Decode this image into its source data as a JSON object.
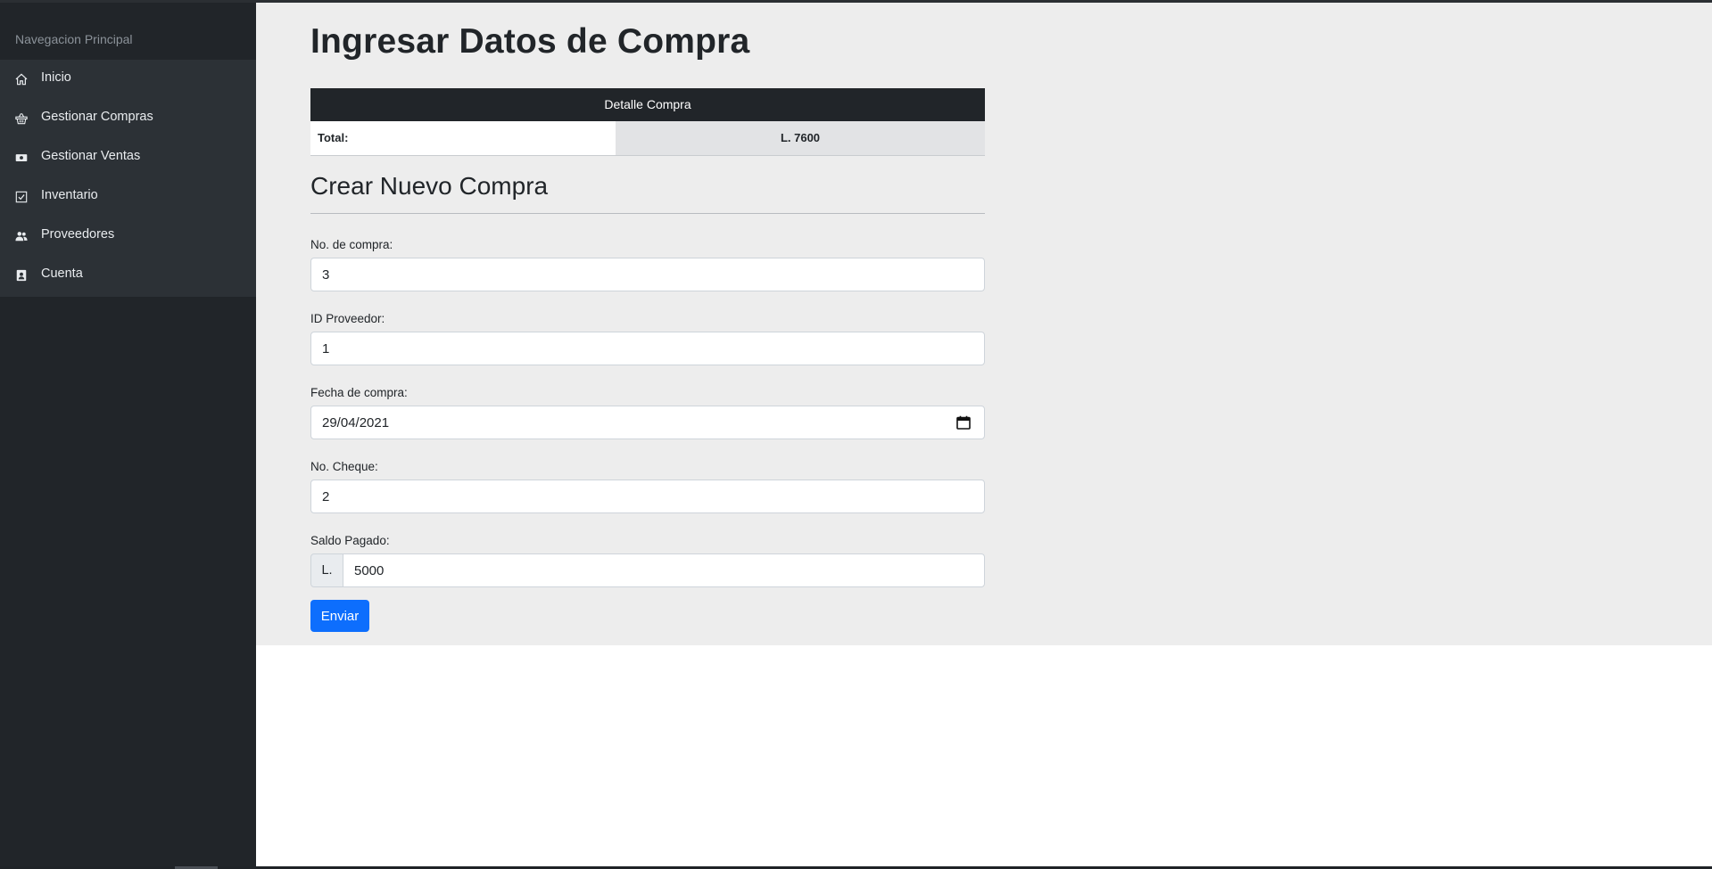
{
  "sidebar": {
    "heading": "Navegacion Principal",
    "items": [
      {
        "label": "Inicio",
        "icon": "home-icon"
      },
      {
        "label": "Gestionar Compras",
        "icon": "basket-icon"
      },
      {
        "label": "Gestionar Ventas",
        "icon": "cash-icon"
      },
      {
        "label": "Inventario",
        "icon": "checklist-icon"
      },
      {
        "label": "Proveedores",
        "icon": "people-icon"
      },
      {
        "label": "Cuenta",
        "icon": "contact-card-icon"
      }
    ]
  },
  "main": {
    "title": "Ingresar Datos de Compra",
    "detail": {
      "header": "Detalle Compra",
      "total_label": "Total:",
      "total_value": "L. 7600"
    },
    "form": {
      "title": "Crear Nuevo Compra",
      "fields": {
        "no_compra": {
          "label": "No. de compra:",
          "value": "3"
        },
        "id_proveedor": {
          "label": "ID Proveedor:",
          "value": "1"
        },
        "fecha_compra": {
          "label": "Fecha de compra:",
          "value": "29/04/2021"
        },
        "no_cheque": {
          "label": "No. Cheque:",
          "value": "2"
        },
        "saldo_pagado": {
          "label": "Saldo Pagado:",
          "prefix": "L.",
          "value": "5000"
        }
      },
      "submit_label": "Enviar"
    }
  },
  "colors": {
    "sidebar_bg": "#212529",
    "nav_panel_bg": "#2c3136",
    "main_bg": "#ededed",
    "table_head_bg": "#212529",
    "primary_button": "#0d6efd"
  }
}
